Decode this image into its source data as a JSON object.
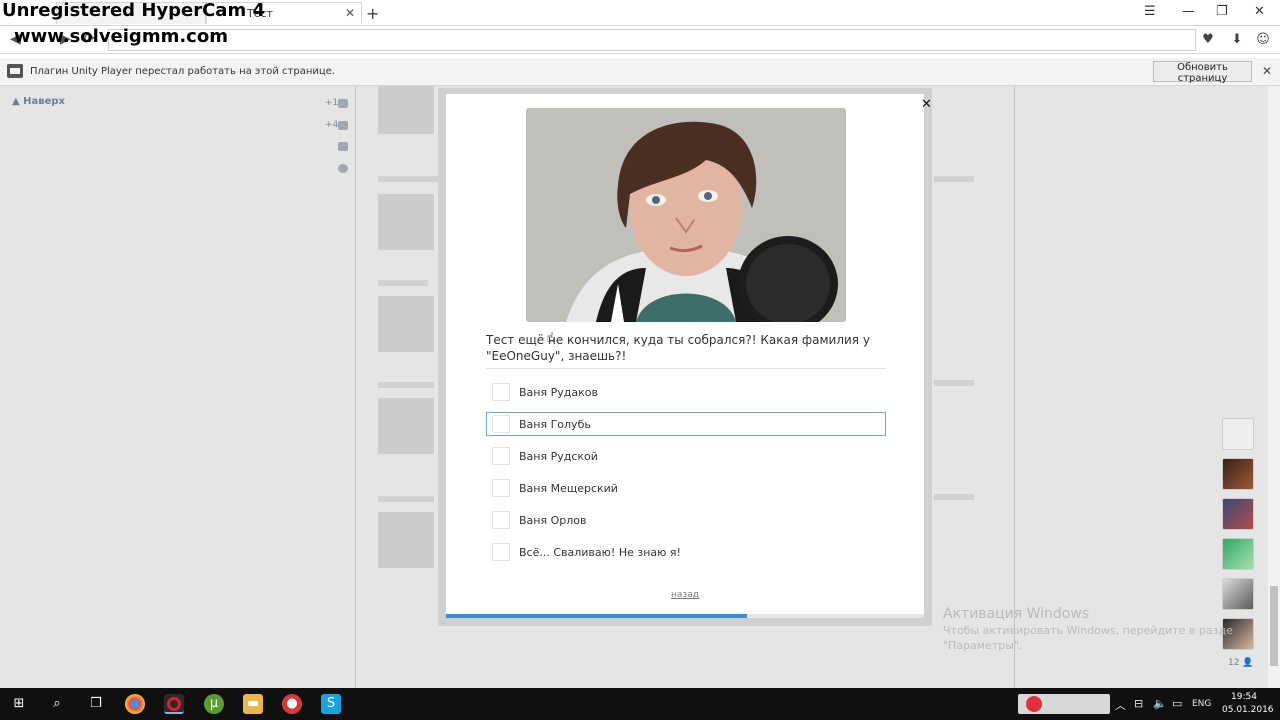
{
  "watermark": {
    "line1": "Unregistered HyperCam 4",
    "line2": "www.solveigmm.com"
  },
  "browser": {
    "tabs": [
      {
        "label": "",
        "active": false
      },
      {
        "label": "Тест",
        "active": true
      }
    ],
    "new_tab": "+",
    "window_controls": {
      "menu": "☰",
      "minimize": "—",
      "restore": "❐",
      "close": "✕"
    },
    "nav": {
      "back": "◀",
      "forward": "▶",
      "reload": "⟳"
    },
    "url": "",
    "icons": {
      "favorite": "♥",
      "download": "⬇",
      "account": "☺"
    }
  },
  "plugin_bar": {
    "message": "Плагин Unity Player перестал работать на этой странице.",
    "reload_button": "Обновить страницу",
    "close": "✕"
  },
  "sidebar": {
    "up_link": "Наверх",
    "stats": [
      {
        "value": "+1",
        "icon": "person-icon"
      },
      {
        "value": "+4",
        "icon": "mail-icon"
      },
      {
        "value": "",
        "icon": "comment-icon"
      },
      {
        "value": "",
        "icon": "gear-icon"
      }
    ]
  },
  "modal": {
    "close": "✕",
    "question": "Тест ещё не кончился, куда ты собрался?! Какая фамилия у \"EeOneGuy\", знаешь?!",
    "options": [
      "Ваня Рудаков",
      "Ваня Голубь",
      "Ваня Рудской",
      "Ваня Мещерский",
      "Ваня Орлов",
      "Всё... Сваливаю! Не знаю я!"
    ],
    "hovered_option_index": 1,
    "back_link": "назад",
    "progress_fraction": 0.63
  },
  "friends": {
    "count": "12"
  },
  "activation": {
    "title": "Активация Windows",
    "line1": "Чтобы активировать Windows, перейдите в разде",
    "line2": "\"Параметры\"."
  },
  "taskbar": {
    "language": "ENG",
    "time": "19:54",
    "date": "05.01.2016"
  },
  "colors": {
    "accent": "#3a8ed8",
    "hover_border": "#6fa9d4",
    "taskbar": "#101010"
  }
}
